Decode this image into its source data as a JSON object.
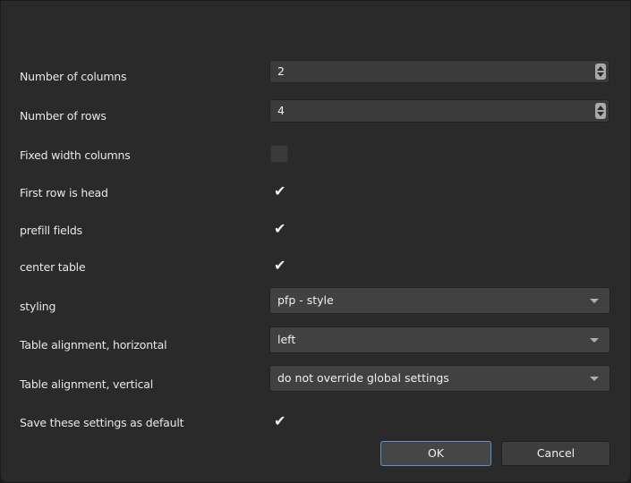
{
  "fields": {
    "columns": {
      "label": "Number of columns",
      "value": "2"
    },
    "rows": {
      "label": "Number of rows",
      "value": "4"
    },
    "fixed_width": {
      "label": "Fixed width columns",
      "checked": false
    },
    "first_row_head": {
      "label": "First row is head",
      "checked": true
    },
    "prefill": {
      "label": "prefill fields",
      "checked": true
    },
    "center_table": {
      "label": "center table",
      "checked": true
    },
    "styling": {
      "label": "styling",
      "value": "pfp - style"
    },
    "align_h": {
      "label": "Table alignment, horizontal",
      "value": "left"
    },
    "align_v": {
      "label": "Table alignment, vertical",
      "value": "do not override global settings"
    },
    "save_default": {
      "label": "Save these settings as default",
      "checked": true
    }
  },
  "buttons": {
    "ok": "OK",
    "cancel": "Cancel"
  },
  "icons": {
    "check": "✔"
  },
  "colors": {
    "background": "#2a2a2a",
    "field": "#3b3b3b",
    "accent": "#6f8fb0"
  }
}
